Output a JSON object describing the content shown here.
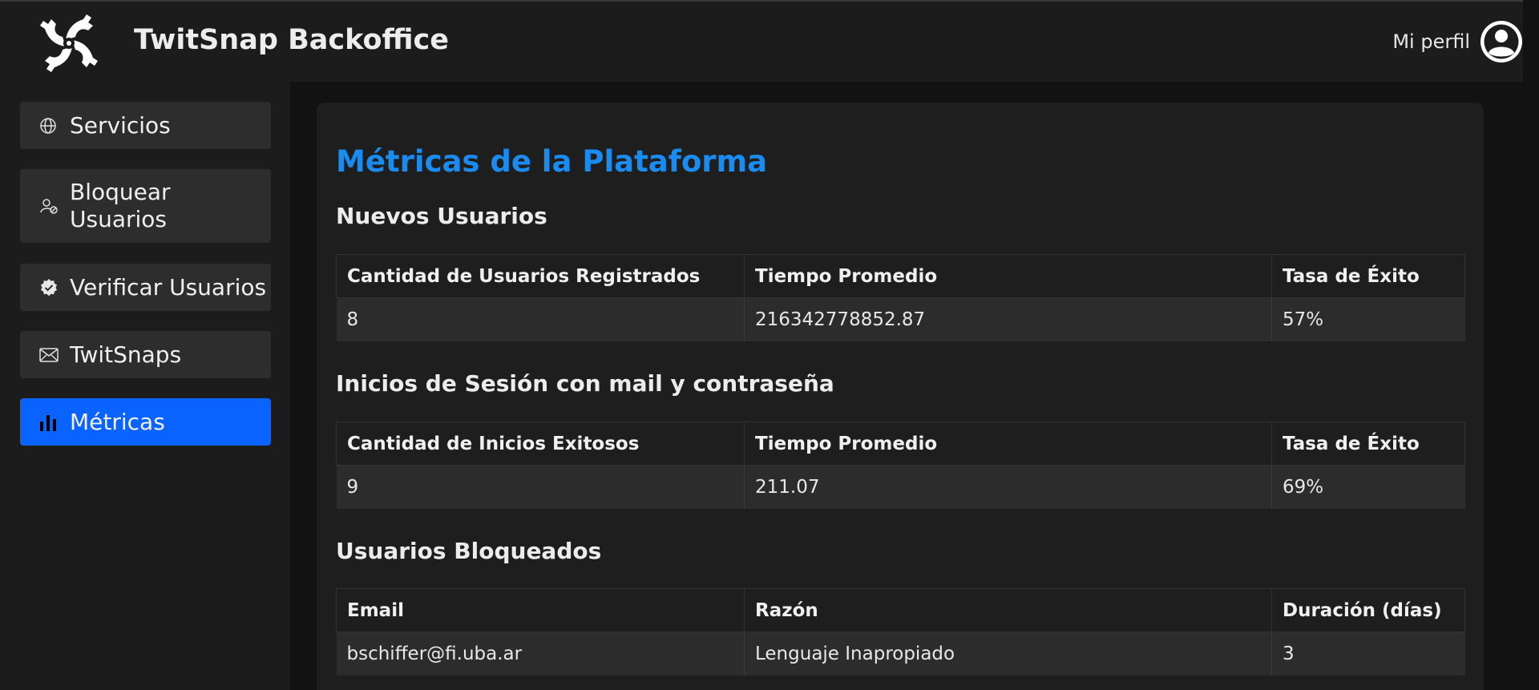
{
  "header": {
    "app_title": "TwitSnap Backoffice",
    "profile_label": "Mi perfil",
    "logo_icon": "pinwheel-logo-icon",
    "profile_icon": "user-circle-icon"
  },
  "sidebar": {
    "items": [
      {
        "label": "Servicios",
        "icon": "globe-icon",
        "active": false
      },
      {
        "label": "Bloquear Usuarios",
        "icon": "user-block-icon",
        "active": false
      },
      {
        "label": "Verificar Usuarios",
        "icon": "verified-badge-icon",
        "active": false
      },
      {
        "label": "TwitSnaps",
        "icon": "envelope-icon",
        "active": false
      },
      {
        "label": "Métricas",
        "icon": "bar-chart-icon",
        "active": true
      }
    ]
  },
  "main": {
    "title": "Métricas de la Plataforma",
    "sections": [
      {
        "title": "Nuevos Usuarios",
        "columns": [
          "Cantidad de Usuarios Registrados",
          "Tiempo Promedio",
          "Tasa de Éxito"
        ],
        "rows": [
          [
            "8",
            "216342778852.87",
            "57%"
          ]
        ]
      },
      {
        "title": "Inicios de Sesión con mail y contraseña",
        "columns": [
          "Cantidad de Inicios Exitosos",
          "Tiempo Promedio",
          "Tasa de Éxito"
        ],
        "rows": [
          [
            "9",
            "211.07",
            "69%"
          ]
        ]
      },
      {
        "title": "Usuarios Bloqueados",
        "columns": [
          "Email",
          "Razón",
          "Duración (días)"
        ],
        "rows": [
          [
            "bschiffer@fi.uba.ar",
            "Lenguaje Inapropiado",
            "3"
          ]
        ]
      }
    ]
  },
  "colors": {
    "accent": "#1a8cf0",
    "active_nav": "#0a62ff",
    "background": "#121212",
    "panel": "#1e1e1e"
  }
}
